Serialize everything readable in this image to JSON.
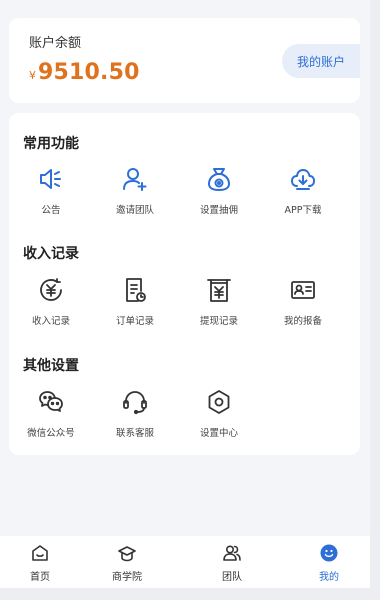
{
  "balance": {
    "label": "账户余额",
    "currency": "¥",
    "amount": "9510.50",
    "account_button": "我的账户"
  },
  "sections": {
    "common": {
      "title": "常用功能",
      "items": [
        {
          "label": "公告",
          "icon": "announcement-icon"
        },
        {
          "label": "邀请团队",
          "icon": "invite-team-icon"
        },
        {
          "label": "设置抽佣",
          "icon": "commission-icon"
        },
        {
          "label": "APP下载",
          "icon": "download-icon"
        }
      ]
    },
    "income": {
      "title": "收入记录",
      "items": [
        {
          "label": "收入记录",
          "icon": "income-icon"
        },
        {
          "label": "订单记录",
          "icon": "order-record-icon"
        },
        {
          "label": "提现记录",
          "icon": "withdraw-icon"
        },
        {
          "label": "我的报备",
          "icon": "report-icon"
        }
      ]
    },
    "other": {
      "title": "其他设置",
      "items": [
        {
          "label": "微信公众号",
          "icon": "wechat-icon"
        },
        {
          "label": "联系客服",
          "icon": "customer-service-icon"
        },
        {
          "label": "设置中心",
          "icon": "settings-icon"
        }
      ]
    }
  },
  "nav": {
    "items": [
      {
        "label": "首页",
        "icon": "home-icon"
      },
      {
        "label": "商学院",
        "icon": "academy-icon"
      },
      {
        "label": "团队",
        "icon": "team-icon"
      },
      {
        "label": "我的",
        "icon": "profile-icon",
        "active": true
      }
    ]
  },
  "colors": {
    "accent": "#2d6fd6",
    "amount": "#e0711d",
    "background": "#f3f5f9"
  }
}
